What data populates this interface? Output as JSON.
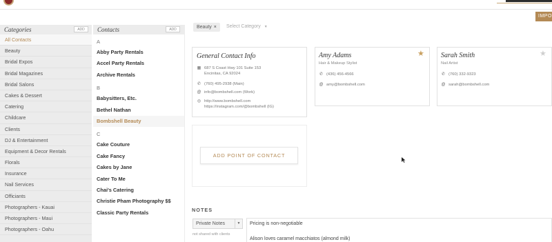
{
  "header": {
    "import_label": "IMPO"
  },
  "categories": {
    "title": "Categories",
    "add_label": "ADD",
    "items": [
      "All Contacts",
      "Beauty",
      "Bridal Expos",
      "Bridal Magazines",
      "Bridal Salons",
      "Cakes & Dessert",
      "Catering",
      "Childcare",
      "Clients",
      "DJ & Entertainment",
      "Equipment & Decor Rentals",
      "Florals",
      "Insurance",
      "Nail Services",
      "Officiants",
      "Photographers - Kauai",
      "Photographers - Maui",
      "Photographers - Oahu"
    ],
    "active": "All Contacts"
  },
  "contacts": {
    "title": "Contacts",
    "add_label": "ADD",
    "letters": [
      "A",
      "B",
      "C"
    ],
    "group_a": [
      "Abby Party Rentals",
      "Accel Party Rentals",
      "Archive Rentals"
    ],
    "group_b": [
      "Babysitters, Etc.",
      "Bethel Nathan",
      "Bombshell Beauty"
    ],
    "group_c": [
      "Cake Couture",
      "Cake Fancy",
      "Cakes by Jane",
      "Cater To Me",
      "Chai's Catering",
      "Christie Pham Photography $$",
      "Classic Party Rentals"
    ],
    "active": "Bombshell Beauty"
  },
  "filter": {
    "chip_label": "Beauty",
    "chip_close": "×",
    "select_placeholder": "Select Category"
  },
  "general_card": {
    "title": "General Contact Info",
    "address1": "687 S Coast Hwy 101 Suite 153",
    "address2": "Encinitas, CA 92024",
    "phone": "(760) 495-2938 (Main)",
    "email": "info@bombshell.com (Work)",
    "website": "http://www.bombshell.com",
    "instagram": "https://instagram.com/@bombshell (IG)"
  },
  "poc_cards": [
    {
      "name": "Amy Adams",
      "role": "Hair & Makeup Stylist",
      "phone": "(436) 456-4566",
      "email": "amy@bombshell.com",
      "starred": true
    },
    {
      "name": "Sarah Smith",
      "role": "Nail Artist",
      "phone": "(760) 332-9323",
      "email": "sarah@bombshell.com",
      "starred": false
    }
  ],
  "add_poc_label": "ADD POINT OF CONTACT",
  "notes": {
    "title": "NOTES",
    "select_value": "Private Notes",
    "hint": "not shared with clients",
    "lines": [
      "Pricing is non-negotiable",
      "Alison loves caramel macchiatos (almond milk)"
    ]
  },
  "colors": {
    "accent": "#b48a55",
    "star_filled": "#c9a060",
    "star_empty": "#cfcfcf",
    "sidebar_bg": "#ececec"
  }
}
